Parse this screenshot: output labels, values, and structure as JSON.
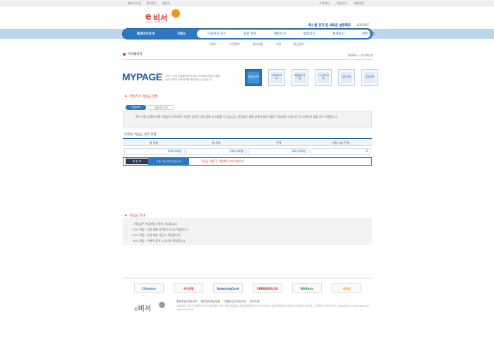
{
  "top": {
    "left_links": [
      "웹하우스앱",
      "즐겨찾기",
      "폴른다"
    ],
    "right_links": [
      "고객센터",
      "이용안내",
      "회원정보"
    ]
  },
  "logo": {
    "main": "비서",
    "letter": "e",
    "sub": "esecretary"
  },
  "header": {
    "slogan": "매스컴 전자 된 새로운 설명해요",
    "logout": "LOGOUT"
  },
  "nav": {
    "left": [
      "홈앤비서안내",
      "거래소"
    ],
    "right": [
      "이용정보 모두",
      "동업 경로",
      "해외상식",
      "법령상식",
      "회계상식",
      "관련 칼럼"
    ]
  },
  "subnav": [
    "서비스",
    "고객정보",
    "공지사항",
    "고객",
    "정산관리"
  ],
  "breadcrumb": {
    "title": "마이페이지",
    "path": "HOME > 마이페이지"
  },
  "mypage": {
    "title": "MYPAGE",
    "desc": "서비스 이용 정보를 확인하세요. 마이페이지에서 회원님의 정보와 이용내역을 확인하실 수 있습니다.",
    "tiles": [
      "적립금 관리",
      "구매내역 조회",
      "회원정보 수정",
      "1:1 문의 내역",
      "쿠폰 관리",
      "결제 관리"
    ]
  },
  "reserve": {
    "section_title": "마일리지 적립금 현황",
    "tabs": [
      "적립내역",
      "사용내역 보기"
    ],
    "info": "항목 사용 금액에 대해 적립금이 부여되며, 적립된 금액은 다음 결제 시 사용할 수 있습니다. 적립금은 결제 금액의 일정 비율로 적립되며, 유효기간 내 사용하지 않을 경우 소멸됩니다."
  },
  "table": {
    "title": "이번달 적립금 내역 현황",
    "headers": [
      "총 적립",
      "총 사용",
      "잔액",
      "사용 가능 잔액"
    ],
    "values": [
      "100,000원",
      "100,000원",
      "100,000원",
      "0"
    ]
  },
  "total": {
    "label": "총 잔 액",
    "middle": "사용 가능 잔액 있습니다",
    "right": "적립금 이용 후 이용해주시기 바랍니다"
  },
  "notice": {
    "title": "적립금 안내",
    "lines": [
      "- 적립금은 현금처럼 사용이 가능합니다.",
      "10% 적립 : 상품 결제 금액의 10%가 적립됩니다.",
      "20% 적립 : 추천 회원 가입 시 적립됩니다.",
      "30% 적립 : 이벤트 참여 시 추가로 적립됩니다."
    ]
  },
  "partners": [
    {
      "name": "Cfinance",
      "color": "#2e78c3"
    },
    {
      "name": "우리은행",
      "color": "#e4312b"
    },
    {
      "name": "SamsungCard",
      "color": "#1d5ea3"
    },
    {
      "name": "ERRENSOLUS",
      "color": "#c0392b"
    },
    {
      "name": "NHBank",
      "color": "#2b9a4a"
    },
    {
      "name": "에듀원",
      "color": "#f7941d"
    }
  ],
  "footer": {
    "links": [
      "회원약관/개인정보",
      "개인정보취급방침",
      "이메일무단수집거부",
      "사이트맵"
    ],
    "address": "서울특별시 강남구 테헤란로 000 이비서빌딩 0층 | 대표 홍길동 | 사업자등록번호 000-00-00000 | 통신판매업신고 제0000-서울강남-0000호 | 고객센터 0000-0000 | Copyright (c) esecretary All rights reserved."
  }
}
